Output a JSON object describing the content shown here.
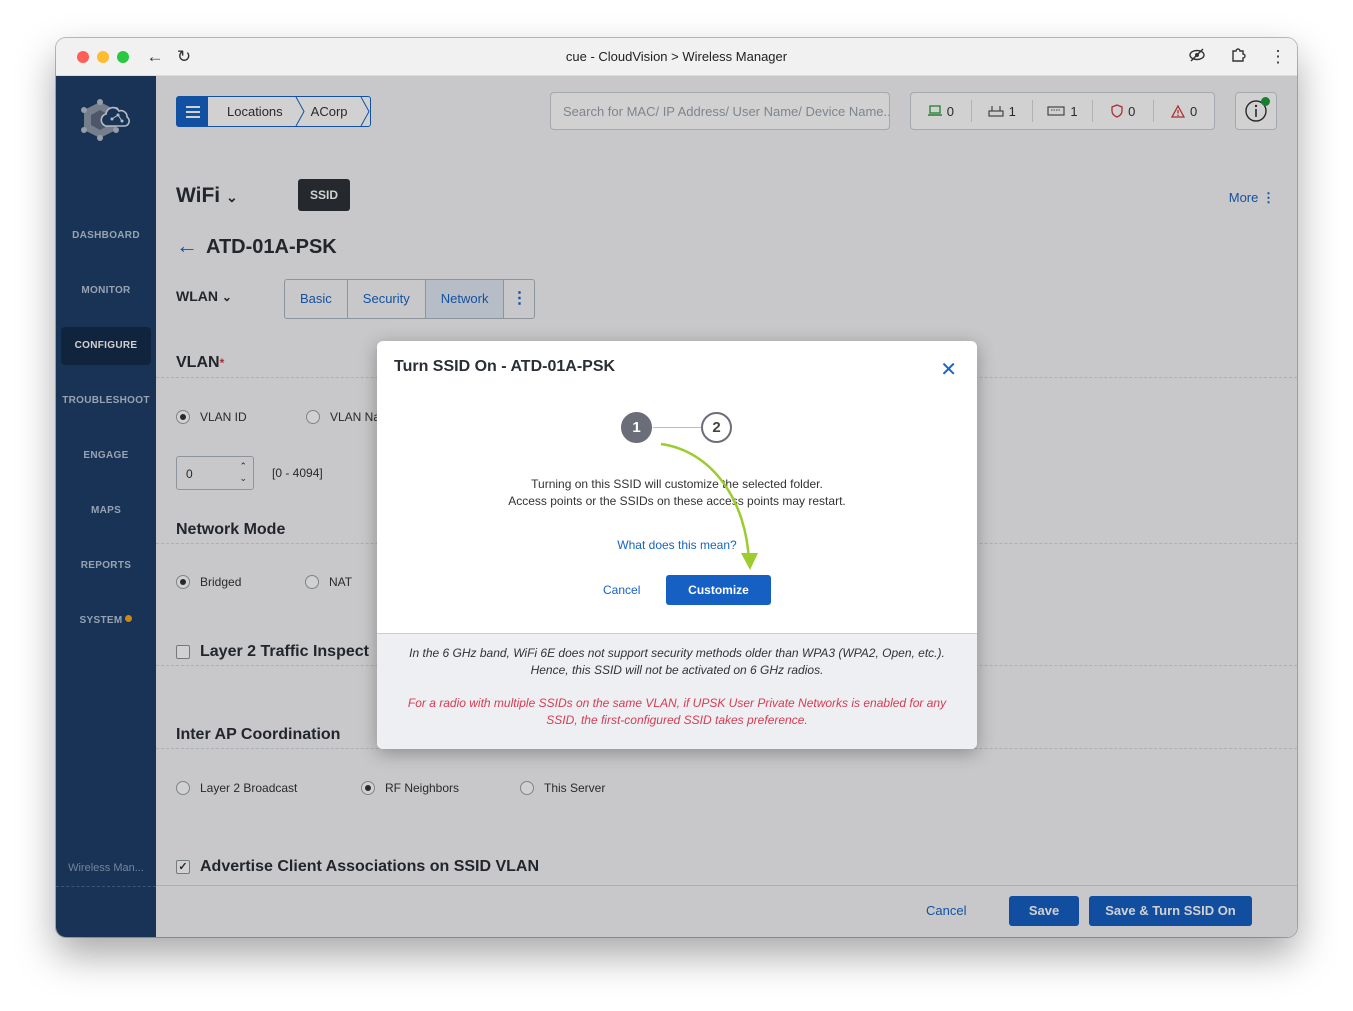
{
  "window": {
    "title": "cue - CloudVision > Wireless Manager"
  },
  "sidebar": {
    "items": [
      {
        "label": "DASHBOARD"
      },
      {
        "label": "MONITOR"
      },
      {
        "label": "CONFIGURE"
      },
      {
        "label": "TROUBLESHOOT"
      },
      {
        "label": "ENGAGE"
      },
      {
        "label": "MAPS"
      },
      {
        "label": "REPORTS"
      },
      {
        "label": "SYSTEM"
      }
    ],
    "footer": "Wireless Man...",
    "active_color": "#152c4c",
    "bg_color": "#1f3f6a"
  },
  "header": {
    "breadcrumb": [
      "Locations",
      "ACorp"
    ],
    "search_placeholder": "Search for MAC/ IP Address/ User Name/ Device Name...",
    "stats": [
      {
        "icon": "laptop-icon",
        "value": "0"
      },
      {
        "icon": "access-point-icon",
        "value": "1"
      },
      {
        "icon": "switch-icon",
        "value": "1"
      },
      {
        "icon": "shield-icon",
        "value": "0"
      },
      {
        "icon": "warning-icon",
        "value": "0"
      }
    ]
  },
  "page": {
    "wifi_label": "WiFi",
    "ssid_badge": "SSID",
    "more_label": "More",
    "ssid_name": "ATD-01A-PSK",
    "wlan_label": "WLAN",
    "tabs": [
      "Basic",
      "Security",
      "Network"
    ],
    "active_tab": "Network",
    "vlan": {
      "title": "VLAN",
      "required": "*",
      "options": [
        "VLAN ID",
        "VLAN Na"
      ],
      "value": "0",
      "range": "[0 - 4094]"
    },
    "network_mode": {
      "title": "Network Mode",
      "options": [
        "Bridged",
        "NAT"
      ]
    },
    "layer2": {
      "title": "Layer 2 Traffic Inspect"
    },
    "inter_ap": {
      "title": "Inter AP Coordination",
      "options": [
        "Layer 2 Broadcast",
        "RF Neighbors",
        "This Server"
      ]
    },
    "advertise": {
      "title": "Advertise Client Associations on SSID VLAN"
    },
    "footer": {
      "cancel": "Cancel",
      "save": "Save",
      "save_turn_on": "Save & Turn SSID On"
    }
  },
  "modal": {
    "title": "Turn SSID On - ATD-01A-PSK",
    "steps": [
      "1",
      "2"
    ],
    "message_line1": "Turning on this SSID will customize the selected folder.",
    "message_line2": "Access points or the SSIDs on these access points may restart.",
    "help_link": "What does this mean?",
    "cancel": "Cancel",
    "customize": "Customize",
    "note1_line1": "In the 6 GHz band, WiFi 6E does not support security methods older than WPA3 (WPA2, Open, etc.).",
    "note1_line2": "Hence, this SSID will not be activated on 6 GHz radios.",
    "note2": "For a radio with multiple SSIDs on the same VLAN, if UPSK User Private Networks is enabled for any SSID, the first-configured SSID takes preference.",
    "primary_color": "#1660c4",
    "warning_color": "#d83b52",
    "arrow_color": "#9ccc2e"
  }
}
